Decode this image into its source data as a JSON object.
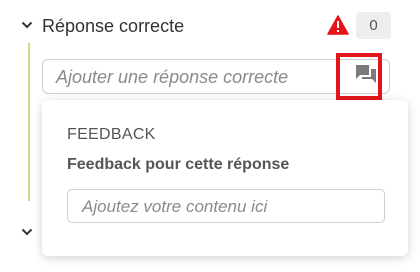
{
  "section": {
    "title": "Réponse correcte",
    "count": "0"
  },
  "answer": {
    "placeholder": "Ajouter une réponse correcte"
  },
  "feedback": {
    "heading": "FEEDBACK",
    "label": "Feedback pour cette réponse",
    "placeholder": "Ajoutez votre contenu ici"
  },
  "icons": {
    "chevron": "chevron-down-icon",
    "warning": "warning-icon",
    "comment": "comment-icon"
  },
  "colors": {
    "warning": "#e5141b",
    "highlight": "#e5141b",
    "rule": "#c9de82",
    "badge_bg": "#ededed"
  }
}
